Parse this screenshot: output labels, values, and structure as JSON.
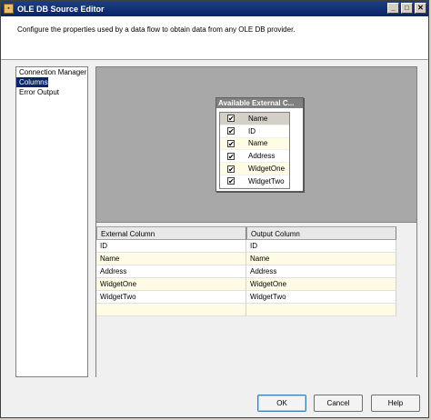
{
  "window": {
    "title": "OLE DB Source Editor",
    "controls": {
      "minimize": "_",
      "maximize": "□",
      "close": "✕"
    }
  },
  "description": "Configure the properties used by a data flow to obtain data from any OLE DB provider.",
  "nav": {
    "items": [
      "Connection Manager",
      "Columns",
      "Error Output"
    ],
    "selected": "Columns"
  },
  "available_columns": {
    "title": "Available External C...",
    "header_label": "Name",
    "rows": [
      {
        "name": "ID",
        "checked": true
      },
      {
        "name": "Name",
        "checked": true
      },
      {
        "name": "Address",
        "checked": true
      },
      {
        "name": "WidgetOne",
        "checked": true
      },
      {
        "name": "WidgetTwo",
        "checked": true
      }
    ]
  },
  "mapping_grid": {
    "headers": [
      "External Column",
      "Output Column"
    ],
    "rows": [
      [
        "ID",
        "ID"
      ],
      [
        "Name",
        "Name"
      ],
      [
        "Address",
        "Address"
      ],
      [
        "WidgetOne",
        "WidgetOne"
      ],
      [
        "WidgetTwo",
        "WidgetTwo"
      ],
      [
        "",
        ""
      ]
    ]
  },
  "buttons": {
    "ok": "OK",
    "cancel": "Cancel",
    "help": "Help"
  },
  "icons": {
    "check": "✔"
  }
}
